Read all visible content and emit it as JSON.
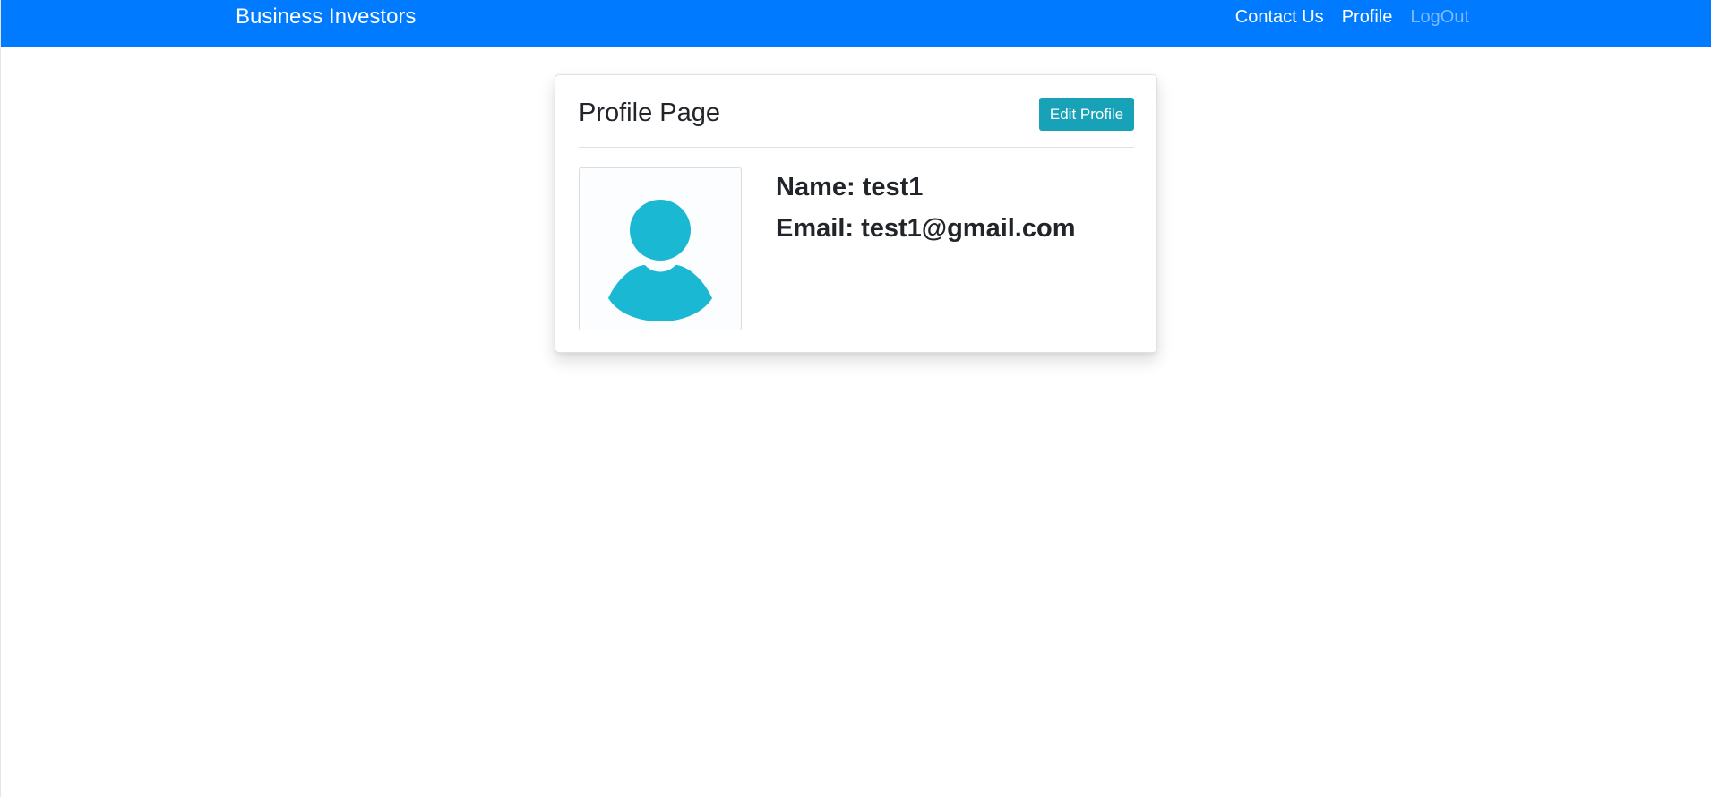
{
  "navbar": {
    "brand": "Business Investors",
    "links": [
      {
        "label": "Contact Us"
      },
      {
        "label": "Profile"
      },
      {
        "label": "LogOut"
      }
    ]
  },
  "profile_card": {
    "title": "Profile Page",
    "edit_label": "Edit Profile",
    "avatar_icon": "user-avatar-icon",
    "name_line": "Name: test1",
    "email_line": "Email: test1@gmail.com"
  },
  "colors": {
    "navbar": "#007bff",
    "button": "#17a2b8",
    "avatar": "#1bb8d4",
    "text": "#212529"
  }
}
